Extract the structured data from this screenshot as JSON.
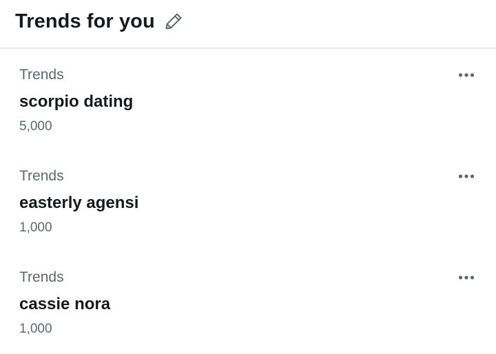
{
  "header": {
    "title": "Trends for you",
    "edit_icon": "pencil-icon"
  },
  "trends": [
    {
      "category": "Trends",
      "name": "scorpio dating",
      "count": "5,000",
      "menu_icon": "more-horizontal-icon"
    },
    {
      "category": "Trends",
      "name": "easterly agensi",
      "count": "1,000",
      "menu_icon": "more-horizontal-icon"
    },
    {
      "category": "Trends",
      "name": "cassie nora",
      "count": "1,000",
      "menu_icon": "more-horizontal-icon"
    }
  ],
  "colors": {
    "text_primary": "#171a1d",
    "text_secondary": "#5c6770",
    "divider": "#e6e9eb",
    "icon": "#5c6770"
  }
}
